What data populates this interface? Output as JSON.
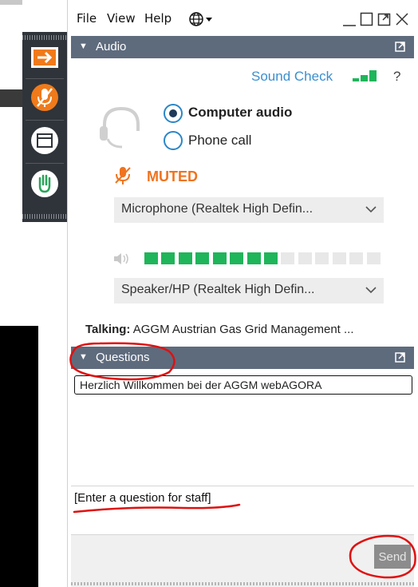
{
  "menu": {
    "file": "File",
    "view": "View",
    "help": "Help"
  },
  "audio_panel": {
    "title": "Audio",
    "sound_check_label": "Sound Check",
    "help": "?",
    "mode_options": [
      {
        "label": "Computer audio",
        "selected": true
      },
      {
        "label": "Phone call",
        "selected": false
      }
    ],
    "mute_status": "MUTED",
    "microphone_select": "Microphone (Realtek High Defin...",
    "speaker_select": "Speaker/HP (Realtek High Defin...",
    "speaker_level": {
      "active": 8,
      "total": 14
    },
    "talking_label": "Talking:",
    "talking_name": "AGGM Austrian Gas Grid Management ..."
  },
  "questions_panel": {
    "title": "Questions",
    "messages": [
      "Herzlich Willkommen bei der AGGM webAGORA"
    ],
    "input_placeholder": "[Enter a question for staff]",
    "send_label": "Send"
  },
  "colors": {
    "accent_blue": "#3b8fcf",
    "muted_orange": "#f0731e",
    "level_green": "#1fb55a",
    "header_slate": "#5e6b7d",
    "annotation_red": "#e01010"
  },
  "icons": {
    "toolbar": [
      "arrow-right-icon",
      "mic-muted-icon",
      "window-icon",
      "raise-hand-icon"
    ],
    "menubar": [
      "globe-icon",
      "minimize-icon",
      "restore-icon",
      "popout-icon",
      "close-icon"
    ]
  }
}
